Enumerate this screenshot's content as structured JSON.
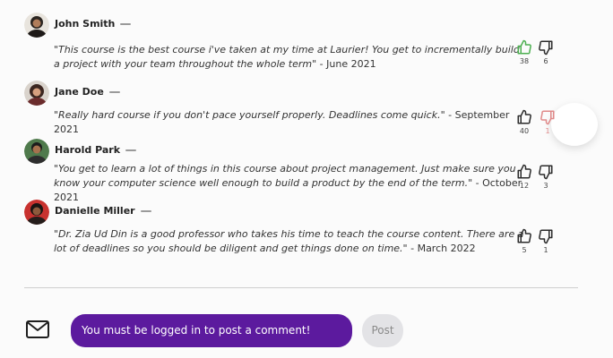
{
  "colors": {
    "accent_purple": "#5c1a9e",
    "like_active_green": "#4caf50",
    "dislike_hover_red": "#e08a8a",
    "post_button_bg": "#e3e3e6"
  },
  "comments": [
    {
      "author": "John Smith",
      "quote": "\"This course is the best course i've taken at my time at Laurier! You get to incrementally build a project with your team throughout the whole term\"",
      "date": " -  June 2021",
      "likes": "38",
      "dislikes": "6",
      "like_state": "active",
      "dislike_state": "default"
    },
    {
      "author": "Jane Doe",
      "quote": "\"Really hard course if you don't pace yourself properly. Deadlines come quick.\"",
      "date": " -  September 2021",
      "likes": "40",
      "dislikes": "1",
      "like_state": "default",
      "dislike_state": "hover"
    },
    {
      "author": "Harold Park",
      "quote": "\"You get to learn a lot of things in this course about project management. Just make sure you know your computer science well enough to build a product by the end of the term.\"",
      "date": " -  October 2021",
      "likes": "12",
      "dislikes": "3",
      "like_state": "default",
      "dislike_state": "default"
    },
    {
      "author": "Danielle Miller",
      "quote": "\"Dr. Zia Ud Din is a good professor who takes his time to teach the course content. There are a lot of deadlines so you should be diligent and get things done on time.\"",
      "date": " -  March 2022",
      "likes": "5",
      "dislikes": "1",
      "like_state": "default",
      "dislike_state": "default"
    }
  ],
  "composer": {
    "icon": "mail-icon",
    "input_text": "You must be logged in to post a comment!",
    "post_label": "Post"
  }
}
